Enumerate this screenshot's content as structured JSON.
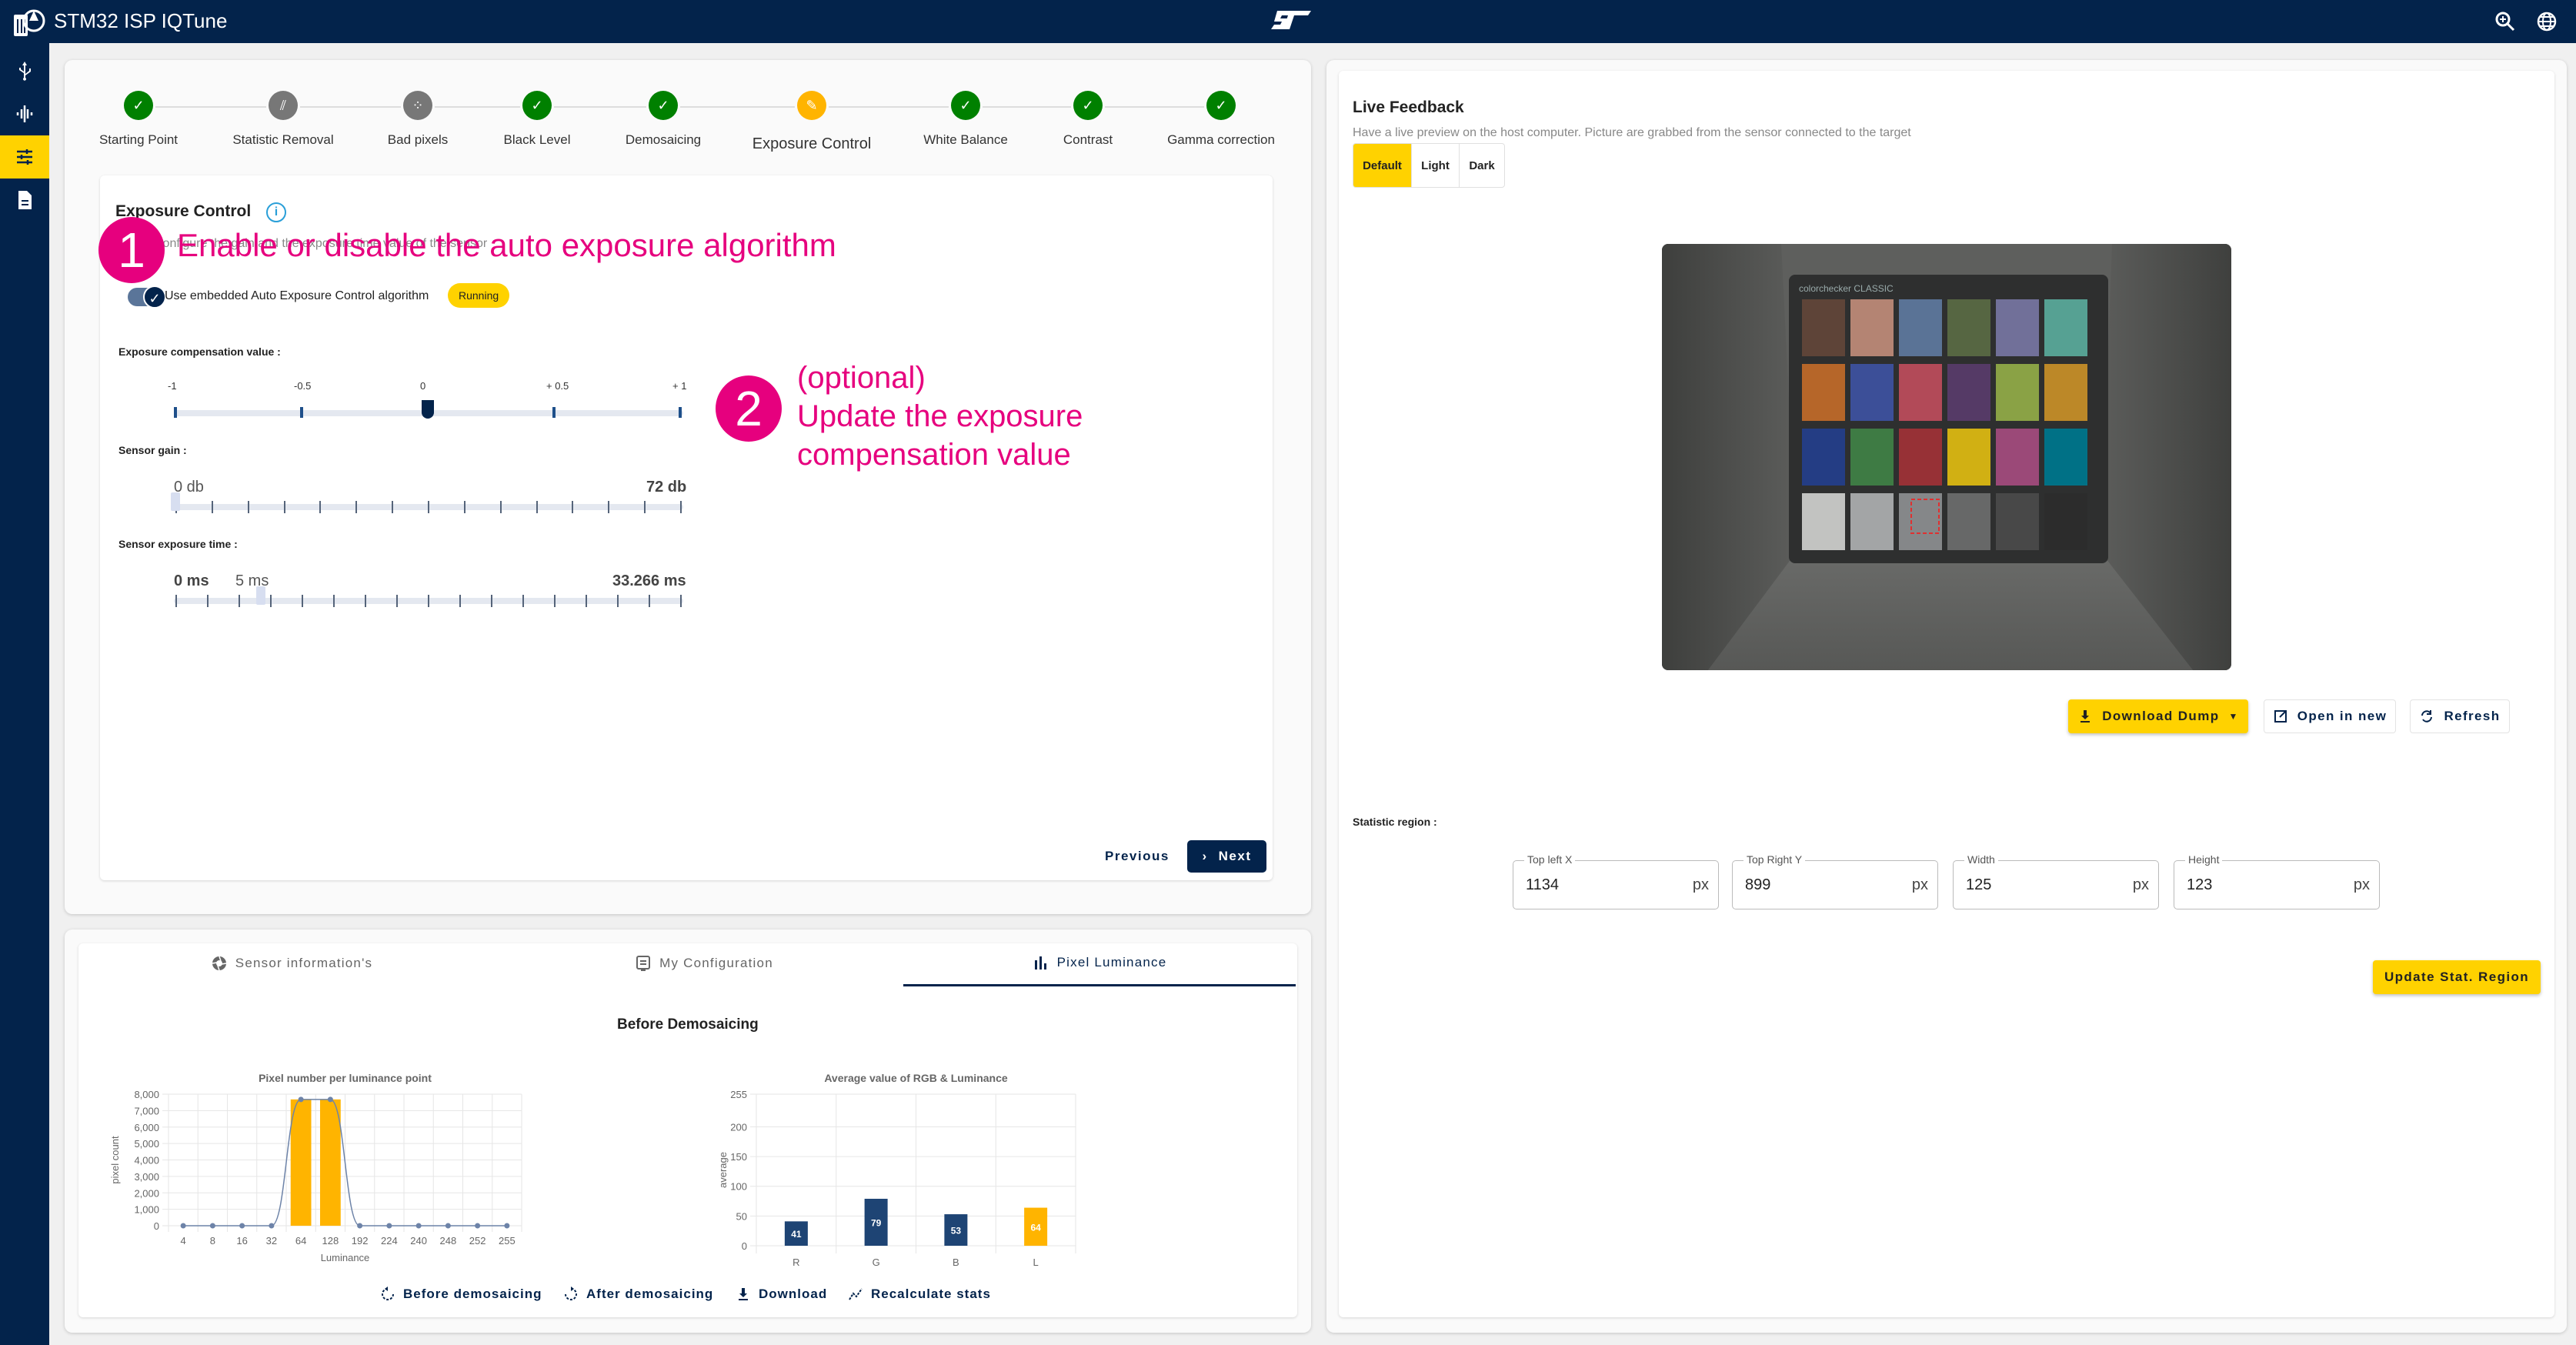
{
  "app": {
    "title": "STM32 ISP IQTune",
    "top_icons": [
      "zoom-in-icon",
      "globe-icon"
    ]
  },
  "sidebar": {
    "items": [
      {
        "icon": "usb-icon",
        "active": false
      },
      {
        "icon": "waveform-icon",
        "active": false
      },
      {
        "icon": "tune-sliders-icon",
        "active": true
      },
      {
        "icon": "document-icon",
        "active": false
      }
    ]
  },
  "stepper": {
    "steps": [
      {
        "label": "Starting Point",
        "state": "done"
      },
      {
        "label": "Statistic Removal",
        "state": "skipped"
      },
      {
        "label": "Bad pixels",
        "state": "skipped"
      },
      {
        "label": "Black Level",
        "state": "done"
      },
      {
        "label": "Demosaicing",
        "state": "done"
      },
      {
        "label": "Exposure Control",
        "state": "current"
      },
      {
        "label": "White Balance",
        "state": "done"
      },
      {
        "label": "Contrast",
        "state": "done"
      },
      {
        "label": "Gamma correction",
        "state": "done"
      }
    ],
    "colors": {
      "done": "#008000",
      "skipped": "#777777",
      "current": "#ffb400"
    }
  },
  "exposure": {
    "title": "Exposure Control",
    "subtitle": "Configure the gain and the exposure time value of the sensor",
    "toggle_label": "Use embedded Auto Exposure Control algorithm",
    "toggle_on": true,
    "status_badge": "Running",
    "compensation": {
      "label": "Exposure compensation value :",
      "marks": [
        "-1",
        "-0.5",
        "0",
        "+ 0.5",
        "+ 1"
      ],
      "min": -1,
      "max": 1,
      "value": 0
    },
    "gain": {
      "label": "Sensor gain :",
      "value_label": "0 db",
      "max_label": "72 db",
      "min": 0,
      "max": 72,
      "value": 0
    },
    "exposure_time": {
      "label": "Sensor exposure time :",
      "min_label": "0 ms",
      "value_label": "5 ms",
      "max_label": "33.266 ms",
      "min": 0,
      "max": 33.266,
      "value": 5
    },
    "previous_label": "Previous",
    "next_label": "Next"
  },
  "annotations": [
    {
      "number": "1",
      "text": "Enable or disable the auto exposure algorithm"
    },
    {
      "number": "2",
      "lines": [
        "(optional)",
        "Update the exposure",
        "compensation value"
      ]
    }
  ],
  "bottom_tabs": {
    "tabs": [
      {
        "label": "Sensor information's",
        "icon": "aperture-icon",
        "active": false
      },
      {
        "label": "My Configuration",
        "icon": "configuration-icon",
        "active": false
      },
      {
        "label": "Pixel Luminance",
        "icon": "bar-chart-icon",
        "active": true
      }
    ],
    "heading": "Before Demosaicing",
    "actions": [
      {
        "label": "Before demosaicing",
        "icon": "rotate-left-icon"
      },
      {
        "label": "After demosaicing",
        "icon": "rotate-right-icon"
      },
      {
        "label": "Download",
        "icon": "download-icon"
      },
      {
        "label": "Recalculate stats",
        "icon": "stats-icon"
      }
    ]
  },
  "chart_data": [
    {
      "type": "bar",
      "title": "Pixel number per luminance point",
      "xlabel": "Luminance",
      "ylabel": "pixel count",
      "categories": [
        "4",
        "8",
        "16",
        "32",
        "64",
        "128",
        "192",
        "224",
        "240",
        "248",
        "252",
        "255"
      ],
      "series": [
        {
          "name": "histogram",
          "kind": "bar",
          "color": "#ffb400",
          "values": [
            0,
            0,
            0,
            0,
            7680,
            7680,
            0,
            0,
            0,
            0,
            0,
            0
          ]
        },
        {
          "name": "curve",
          "kind": "line",
          "color": "#6d83a8",
          "values": [
            0,
            0,
            0,
            0,
            7680,
            7680,
            0,
            0,
            0,
            0,
            0,
            0
          ]
        }
      ],
      "yticks": [
        "0",
        "1,000",
        "2,000",
        "3,000",
        "4,000",
        "5,000",
        "6,000",
        "7,000",
        "8,000"
      ],
      "ylim": [
        0,
        8000
      ],
      "grid": true
    },
    {
      "type": "bar",
      "title": "Average value of RGB & Luminance",
      "xlabel": "",
      "ylabel": "average",
      "categories": [
        "R",
        "G",
        "B",
        "L"
      ],
      "values": [
        41,
        79,
        53,
        64
      ],
      "colors": [
        "#1e4474",
        "#1e4474",
        "#1e4474",
        "#ffb400"
      ],
      "yticks": [
        "0",
        "50",
        "100",
        "150",
        "200",
        "255"
      ],
      "ylim": [
        0,
        255
      ],
      "grid": true,
      "data_labels": true
    }
  ],
  "live_feedback": {
    "title": "Live Feedback",
    "subtitle": "Have a live preview on the host computer. Picture are grabbed from the sensor connected to the target",
    "modes": [
      {
        "label": "Default",
        "active": true
      },
      {
        "label": "Light",
        "active": false
      },
      {
        "label": "Dark",
        "active": false
      }
    ],
    "preview_caption": "colorchecker CLASSIC",
    "patches": [
      "#5e4438",
      "#b48473",
      "#5a7396",
      "#566642",
      "#717099",
      "#56a193",
      "#b66629",
      "#3c4f98",
      "#b24a58",
      "#553a66",
      "#8aa245",
      "#bc8828",
      "#243d84",
      "#3e7b44",
      "#973136",
      "#d1b013",
      "#9b4978",
      "#007186",
      "#c2c3c1",
      "#a3a5a6",
      "#858789",
      "#676868",
      "#484848",
      "#2c2c2c"
    ],
    "download_label": "Download Dump",
    "open_label": "Open in new",
    "refresh_label": "Refresh",
    "stat_region_label": "Statistic region :",
    "fields": [
      {
        "label": "Top left X",
        "value": "1134",
        "unit": "px"
      },
      {
        "label": "Top Right Y",
        "value": "899",
        "unit": "px"
      },
      {
        "label": "Width",
        "value": "125",
        "unit": "px"
      },
      {
        "label": "Height",
        "value": "123",
        "unit": "px"
      }
    ],
    "update_label": "Update Stat. Region"
  },
  "colors": {
    "navy": "#03234b",
    "yellow": "#ffd200",
    "accent_orange": "#ffb400",
    "annotation_pink": "#e6007e"
  }
}
